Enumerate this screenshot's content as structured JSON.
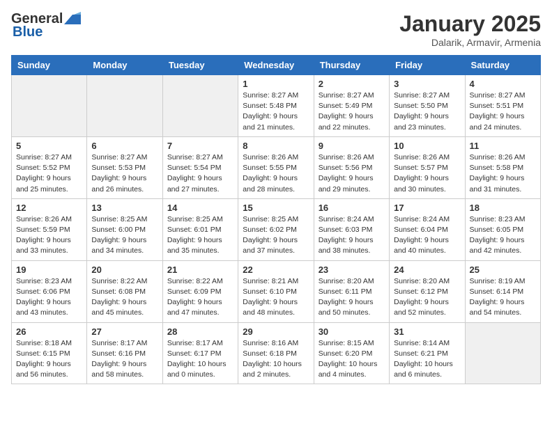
{
  "logo": {
    "general": "General",
    "blue": "Blue"
  },
  "title": "January 2025",
  "location": "Dalarik, Armavir, Armenia",
  "days_header": [
    "Sunday",
    "Monday",
    "Tuesday",
    "Wednesday",
    "Thursday",
    "Friday",
    "Saturday"
  ],
  "weeks": [
    [
      {
        "day": "",
        "info": ""
      },
      {
        "day": "",
        "info": ""
      },
      {
        "day": "",
        "info": ""
      },
      {
        "day": "1",
        "info": "Sunrise: 8:27 AM\nSunset: 5:48 PM\nDaylight: 9 hours and 21 minutes."
      },
      {
        "day": "2",
        "info": "Sunrise: 8:27 AM\nSunset: 5:49 PM\nDaylight: 9 hours and 22 minutes."
      },
      {
        "day": "3",
        "info": "Sunrise: 8:27 AM\nSunset: 5:50 PM\nDaylight: 9 hours and 23 minutes."
      },
      {
        "day": "4",
        "info": "Sunrise: 8:27 AM\nSunset: 5:51 PM\nDaylight: 9 hours and 24 minutes."
      }
    ],
    [
      {
        "day": "5",
        "info": "Sunrise: 8:27 AM\nSunset: 5:52 PM\nDaylight: 9 hours and 25 minutes."
      },
      {
        "day": "6",
        "info": "Sunrise: 8:27 AM\nSunset: 5:53 PM\nDaylight: 9 hours and 26 minutes."
      },
      {
        "day": "7",
        "info": "Sunrise: 8:27 AM\nSunset: 5:54 PM\nDaylight: 9 hours and 27 minutes."
      },
      {
        "day": "8",
        "info": "Sunrise: 8:26 AM\nSunset: 5:55 PM\nDaylight: 9 hours and 28 minutes."
      },
      {
        "day": "9",
        "info": "Sunrise: 8:26 AM\nSunset: 5:56 PM\nDaylight: 9 hours and 29 minutes."
      },
      {
        "day": "10",
        "info": "Sunrise: 8:26 AM\nSunset: 5:57 PM\nDaylight: 9 hours and 30 minutes."
      },
      {
        "day": "11",
        "info": "Sunrise: 8:26 AM\nSunset: 5:58 PM\nDaylight: 9 hours and 31 minutes."
      }
    ],
    [
      {
        "day": "12",
        "info": "Sunrise: 8:26 AM\nSunset: 5:59 PM\nDaylight: 9 hours and 33 minutes."
      },
      {
        "day": "13",
        "info": "Sunrise: 8:25 AM\nSunset: 6:00 PM\nDaylight: 9 hours and 34 minutes."
      },
      {
        "day": "14",
        "info": "Sunrise: 8:25 AM\nSunset: 6:01 PM\nDaylight: 9 hours and 35 minutes."
      },
      {
        "day": "15",
        "info": "Sunrise: 8:25 AM\nSunset: 6:02 PM\nDaylight: 9 hours and 37 minutes."
      },
      {
        "day": "16",
        "info": "Sunrise: 8:24 AM\nSunset: 6:03 PM\nDaylight: 9 hours and 38 minutes."
      },
      {
        "day": "17",
        "info": "Sunrise: 8:24 AM\nSunset: 6:04 PM\nDaylight: 9 hours and 40 minutes."
      },
      {
        "day": "18",
        "info": "Sunrise: 8:23 AM\nSunset: 6:05 PM\nDaylight: 9 hours and 42 minutes."
      }
    ],
    [
      {
        "day": "19",
        "info": "Sunrise: 8:23 AM\nSunset: 6:06 PM\nDaylight: 9 hours and 43 minutes."
      },
      {
        "day": "20",
        "info": "Sunrise: 8:22 AM\nSunset: 6:08 PM\nDaylight: 9 hours and 45 minutes."
      },
      {
        "day": "21",
        "info": "Sunrise: 8:22 AM\nSunset: 6:09 PM\nDaylight: 9 hours and 47 minutes."
      },
      {
        "day": "22",
        "info": "Sunrise: 8:21 AM\nSunset: 6:10 PM\nDaylight: 9 hours and 48 minutes."
      },
      {
        "day": "23",
        "info": "Sunrise: 8:20 AM\nSunset: 6:11 PM\nDaylight: 9 hours and 50 minutes."
      },
      {
        "day": "24",
        "info": "Sunrise: 8:20 AM\nSunset: 6:12 PM\nDaylight: 9 hours and 52 minutes."
      },
      {
        "day": "25",
        "info": "Sunrise: 8:19 AM\nSunset: 6:14 PM\nDaylight: 9 hours and 54 minutes."
      }
    ],
    [
      {
        "day": "26",
        "info": "Sunrise: 8:18 AM\nSunset: 6:15 PM\nDaylight: 9 hours and 56 minutes."
      },
      {
        "day": "27",
        "info": "Sunrise: 8:17 AM\nSunset: 6:16 PM\nDaylight: 9 hours and 58 minutes."
      },
      {
        "day": "28",
        "info": "Sunrise: 8:17 AM\nSunset: 6:17 PM\nDaylight: 10 hours and 0 minutes."
      },
      {
        "day": "29",
        "info": "Sunrise: 8:16 AM\nSunset: 6:18 PM\nDaylight: 10 hours and 2 minutes."
      },
      {
        "day": "30",
        "info": "Sunrise: 8:15 AM\nSunset: 6:20 PM\nDaylight: 10 hours and 4 minutes."
      },
      {
        "day": "31",
        "info": "Sunrise: 8:14 AM\nSunset: 6:21 PM\nDaylight: 10 hours and 6 minutes."
      },
      {
        "day": "",
        "info": ""
      }
    ]
  ]
}
